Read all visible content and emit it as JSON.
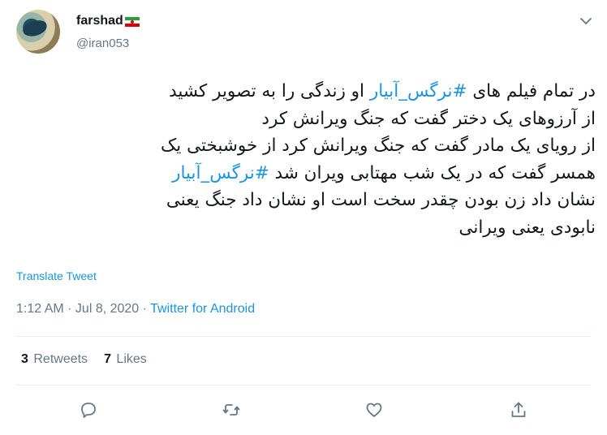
{
  "user": {
    "display_name": "farshad",
    "handle": "@iran053",
    "flag": "iran-flag-icon"
  },
  "tweet": {
    "lines": [
      [
        {
          "t": "در تمام  فیلم های ",
          "h": false
        },
        {
          "t": "#نرگس_آبیار",
          "h": true
        },
        {
          "t": " او زندگی را به تصویر کشید",
          "h": false
        }
      ],
      [
        {
          "t": "از آرزوهای یک دختر گفت که جنگ ویرانش کرد",
          "h": false
        }
      ],
      [
        {
          "t": " از رویای یک مادر گفت که جنگ ویرانش کرد از خوشبختی یک",
          "h": false
        }
      ],
      [
        {
          "t": "همسر گفت که در یک شب مهتابی ویران شد  ",
          "h": false
        },
        {
          "t": "#نرگس_آبیار",
          "h": true
        }
      ],
      [
        {
          "t": "نشان داد زن بودن چقدر سخت است او نشان داد جنگ یعنی",
          "h": false
        }
      ],
      [
        {
          "t": "نابودی یعنی ویرانی",
          "h": false
        }
      ]
    ],
    "translate_label": "Translate Tweet",
    "time": "1:12 AM",
    "separator": " · ",
    "date": "Jul 8, 2020",
    "source": "Twitter for Android"
  },
  "stats": {
    "retweets_count": "3",
    "retweets_label": "Retweets",
    "likes_count": "7",
    "likes_label": "Likes"
  },
  "colors": {
    "link": "#1b95e0",
    "muted": "#657786",
    "text": "#14171a"
  },
  "icons": {
    "more": "chevron-down-icon",
    "reply": "reply-icon",
    "retweet": "retweet-icon",
    "like": "heart-icon",
    "share": "share-icon"
  }
}
